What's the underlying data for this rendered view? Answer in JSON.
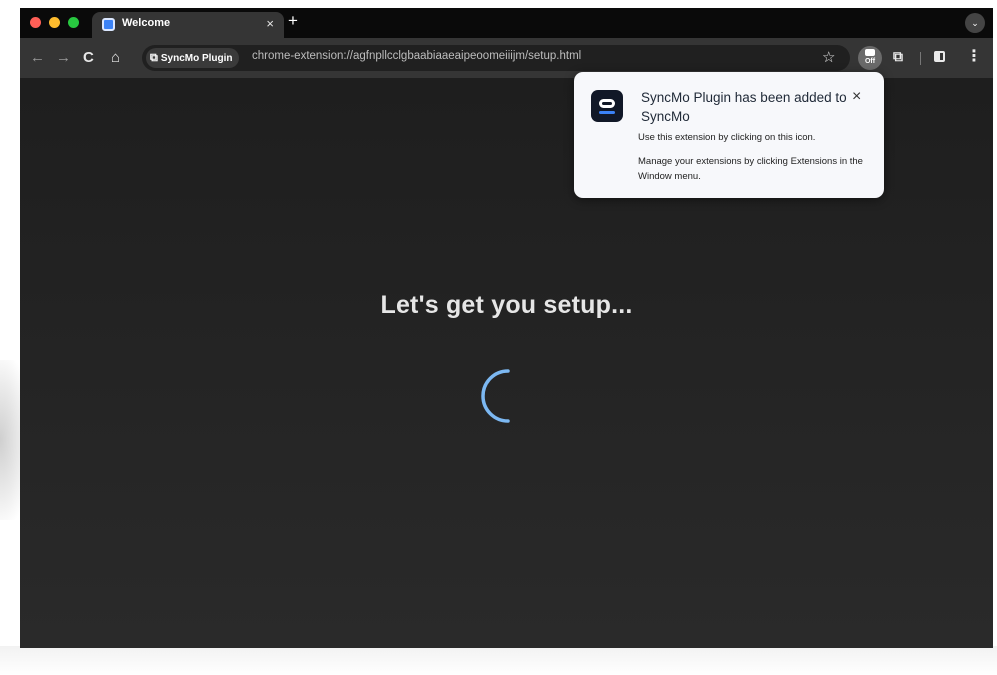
{
  "browser": {
    "tab": {
      "title": "Welcome",
      "close_glyph": "×",
      "favicon": "syncmo-favicon-icon"
    },
    "new_tab_glyph": "+",
    "tab_dropdown_glyph": "⌄",
    "toolbar": {
      "back_glyph": "←",
      "forward_glyph": "→",
      "reload_glyph": "C",
      "home_glyph": "⌂",
      "site_chip_label": "SyncMo Plugin",
      "url": "chrome-extension://agfnpllcclgbaabiaaeaipeoomeiiijm/setup.html",
      "bookmark_glyph": "☆",
      "pinned_extension_badge": "Off",
      "extensions_glyph": "⧉",
      "menu_glyph": "⋮"
    },
    "colors": {
      "tabstrip_bg": "#0a0a0a",
      "toolbar_bg": "#353535",
      "content_bg": "#262626",
      "spinner": "#7cb8f2"
    }
  },
  "page": {
    "heading": "Let's get you setup..."
  },
  "extension_popup": {
    "title": "SyncMo Plugin has been added to SyncMo",
    "close_glyph": "×",
    "line1": "Use this extension by clicking on this icon.",
    "line2": "Manage your extensions by clicking Extensions in the Window menu.",
    "app_icon": "syncmo-app-icon"
  }
}
